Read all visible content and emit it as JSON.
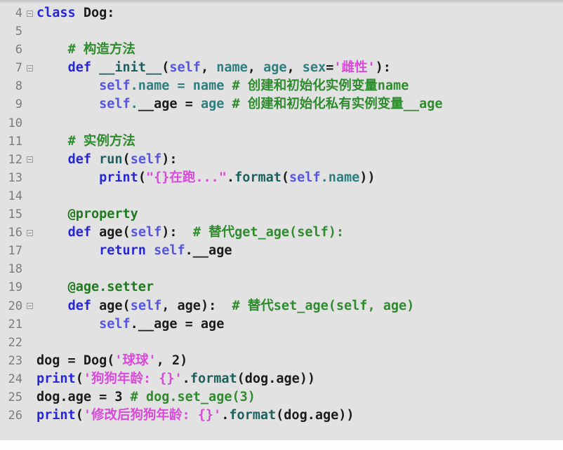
{
  "editor": {
    "name": "python-code-viewer",
    "language": "Python",
    "background_color": "#e2e2e2",
    "gutter_text_color": "#7b7b7b",
    "first_line_number": 4,
    "last_line_number": 26,
    "colors": {
      "keyword": "#2727d8",
      "function_name": "#1c6060",
      "self_keyword": "#5555e0",
      "parameter": "#2c7f7f",
      "string": "#d84ad8",
      "comment": "#2e8b2e",
      "decorator": "#1f7a1f",
      "plain_text": "#1b1b1b"
    }
  },
  "lines": [
    {
      "number": "4",
      "fold": true,
      "text": "class Dog:"
    },
    {
      "number": "5",
      "fold": false,
      "text": ""
    },
    {
      "number": "6",
      "fold": false,
      "text": "    # 构造方法"
    },
    {
      "number": "7",
      "fold": true,
      "text": "    def __init__(self, name, age, sex='雌性'):"
    },
    {
      "number": "8",
      "fold": false,
      "text": "        self.name = name # 创建和初始化实例变量name"
    },
    {
      "number": "9",
      "fold": false,
      "text": "        self.__age = age # 创建和初始化私有实例变量__age"
    },
    {
      "number": "10",
      "fold": false,
      "text": ""
    },
    {
      "number": "11",
      "fold": false,
      "text": "    # 实例方法"
    },
    {
      "number": "12",
      "fold": true,
      "text": "    def run(self):"
    },
    {
      "number": "13",
      "fold": false,
      "text": "        print(\"{}在跑...\".format(self.name))"
    },
    {
      "number": "14",
      "fold": false,
      "text": ""
    },
    {
      "number": "15",
      "fold": false,
      "text": "    @property"
    },
    {
      "number": "16",
      "fold": true,
      "text": "    def age(self):  # 替代get_age(self):"
    },
    {
      "number": "17",
      "fold": false,
      "text": "        return self.__age"
    },
    {
      "number": "18",
      "fold": false,
      "text": ""
    },
    {
      "number": "19",
      "fold": false,
      "text": "    @age.setter"
    },
    {
      "number": "20",
      "fold": true,
      "text": "    def age(self, age):  # 替代set_age(self, age)"
    },
    {
      "number": "21",
      "fold": false,
      "text": "        self.__age = age"
    },
    {
      "number": "22",
      "fold": false,
      "text": ""
    },
    {
      "number": "23",
      "fold": false,
      "text": "dog = Dog('球球', 2)"
    },
    {
      "number": "24",
      "fold": false,
      "text": "print('狗狗年龄: {}'.format(dog.age))"
    },
    {
      "number": "25",
      "fold": false,
      "text": "dog.age = 3 # dog.set_age(3)"
    },
    {
      "number": "26",
      "fold": false,
      "text": "print('修改后狗狗年龄: {}'.format(dog.age))"
    }
  ],
  "tokens": [
    [
      {
        "t": "kw",
        "v": "class"
      },
      {
        "t": "plain",
        "v": " Dog:"
      }
    ],
    [],
    [
      {
        "t": "plain",
        "v": "    "
      },
      {
        "t": "com",
        "v": "# 构造方法"
      }
    ],
    [
      {
        "t": "plain",
        "v": "    "
      },
      {
        "t": "kw",
        "v": "def"
      },
      {
        "t": "plain",
        "v": " "
      },
      {
        "t": "fname",
        "v": "__init__"
      },
      {
        "t": "op",
        "v": "("
      },
      {
        "t": "selfkw",
        "v": "self"
      },
      {
        "t": "op",
        "v": ", "
      },
      {
        "t": "param",
        "v": "name"
      },
      {
        "t": "op",
        "v": ", "
      },
      {
        "t": "param",
        "v": "age"
      },
      {
        "t": "op",
        "v": ", "
      },
      {
        "t": "param",
        "v": "sex"
      },
      {
        "t": "op",
        "v": "="
      },
      {
        "t": "str",
        "v": "'雌性'"
      },
      {
        "t": "op",
        "v": "):"
      }
    ],
    [
      {
        "t": "plain",
        "v": "        "
      },
      {
        "t": "selfkw",
        "v": "self"
      },
      {
        "t": "param",
        "v": ".name"
      },
      {
        "t": "param",
        "v": " = "
      },
      {
        "t": "param",
        "v": "name"
      },
      {
        "t": "plain",
        "v": " "
      },
      {
        "t": "com",
        "v": "# 创建和初始化实例变量name"
      }
    ],
    [
      {
        "t": "plain",
        "v": "        "
      },
      {
        "t": "selfkw",
        "v": "self"
      },
      {
        "t": "param",
        "v": "."
      },
      {
        "t": "plain",
        "v": "__age"
      },
      {
        "t": "plain",
        "v": " = "
      },
      {
        "t": "param",
        "v": "age"
      },
      {
        "t": "plain",
        "v": " "
      },
      {
        "t": "com",
        "v": "# 创建和初始化私有实例变量__age"
      }
    ],
    [],
    [
      {
        "t": "plain",
        "v": "    "
      },
      {
        "t": "com",
        "v": "# 实例方法"
      }
    ],
    [
      {
        "t": "plain",
        "v": "    "
      },
      {
        "t": "kw",
        "v": "def"
      },
      {
        "t": "plain",
        "v": " "
      },
      {
        "t": "fname",
        "v": "run"
      },
      {
        "t": "op",
        "v": "("
      },
      {
        "t": "selfkw",
        "v": "self"
      },
      {
        "t": "op",
        "v": "):"
      }
    ],
    [
      {
        "t": "plain",
        "v": "        "
      },
      {
        "t": "kw",
        "v": "print"
      },
      {
        "t": "op",
        "v": "("
      },
      {
        "t": "str",
        "v": "\"{}在跑...\""
      },
      {
        "t": "op",
        "v": "."
      },
      {
        "t": "fname",
        "v": "format"
      },
      {
        "t": "op",
        "v": "("
      },
      {
        "t": "selfkw",
        "v": "self"
      },
      {
        "t": "param",
        "v": ".name"
      },
      {
        "t": "op",
        "v": "))"
      }
    ],
    [],
    [
      {
        "t": "plain",
        "v": "    "
      },
      {
        "t": "deco",
        "v": "@property"
      }
    ],
    [
      {
        "t": "plain",
        "v": "    "
      },
      {
        "t": "kw",
        "v": "def"
      },
      {
        "t": "plain",
        "v": " "
      },
      {
        "t": "plain",
        "v": "age"
      },
      {
        "t": "op",
        "v": "("
      },
      {
        "t": "selfkw",
        "v": "self"
      },
      {
        "t": "op",
        "v": "):  "
      },
      {
        "t": "com",
        "v": "# 替代get_age(self):"
      }
    ],
    [
      {
        "t": "plain",
        "v": "        "
      },
      {
        "t": "kw",
        "v": "return"
      },
      {
        "t": "plain",
        "v": " "
      },
      {
        "t": "selfkw",
        "v": "self"
      },
      {
        "t": "plain",
        "v": ".__age"
      }
    ],
    [],
    [
      {
        "t": "plain",
        "v": "    "
      },
      {
        "t": "deco",
        "v": "@age.setter"
      }
    ],
    [
      {
        "t": "plain",
        "v": "    "
      },
      {
        "t": "kw",
        "v": "def"
      },
      {
        "t": "plain",
        "v": " "
      },
      {
        "t": "plain",
        "v": "age"
      },
      {
        "t": "op",
        "v": "("
      },
      {
        "t": "selfkw",
        "v": "self"
      },
      {
        "t": "op",
        "v": ", "
      },
      {
        "t": "plain",
        "v": "age"
      },
      {
        "t": "op",
        "v": "):  "
      },
      {
        "t": "com",
        "v": "# 替代set_age(self, age)"
      }
    ],
    [
      {
        "t": "plain",
        "v": "        "
      },
      {
        "t": "selfkw",
        "v": "self"
      },
      {
        "t": "plain",
        "v": ".__age = age"
      }
    ],
    [],
    [
      {
        "t": "plain",
        "v": "dog = Dog("
      },
      {
        "t": "str",
        "v": "'球球'"
      },
      {
        "t": "plain",
        "v": ", "
      },
      {
        "t": "num",
        "v": "2"
      },
      {
        "t": "plain",
        "v": ")"
      }
    ],
    [
      {
        "t": "kw",
        "v": "print"
      },
      {
        "t": "op",
        "v": "("
      },
      {
        "t": "str",
        "v": "'狗狗年龄: {}'"
      },
      {
        "t": "op",
        "v": "."
      },
      {
        "t": "fname",
        "v": "format"
      },
      {
        "t": "op",
        "v": "("
      },
      {
        "t": "plain",
        "v": "dog.age"
      },
      {
        "t": "op",
        "v": "))"
      }
    ],
    [
      {
        "t": "plain",
        "v": "dog.age = "
      },
      {
        "t": "num",
        "v": "3"
      },
      {
        "t": "plain",
        "v": " "
      },
      {
        "t": "com",
        "v": "# dog.set_age(3)"
      }
    ],
    [
      {
        "t": "kw",
        "v": "print"
      },
      {
        "t": "op",
        "v": "("
      },
      {
        "t": "str",
        "v": "'修改后狗狗年龄: {}'"
      },
      {
        "t": "op",
        "v": "."
      },
      {
        "t": "fname",
        "v": "format"
      },
      {
        "t": "op",
        "v": "("
      },
      {
        "t": "plain",
        "v": "dog.age"
      },
      {
        "t": "op",
        "v": "))"
      }
    ]
  ]
}
